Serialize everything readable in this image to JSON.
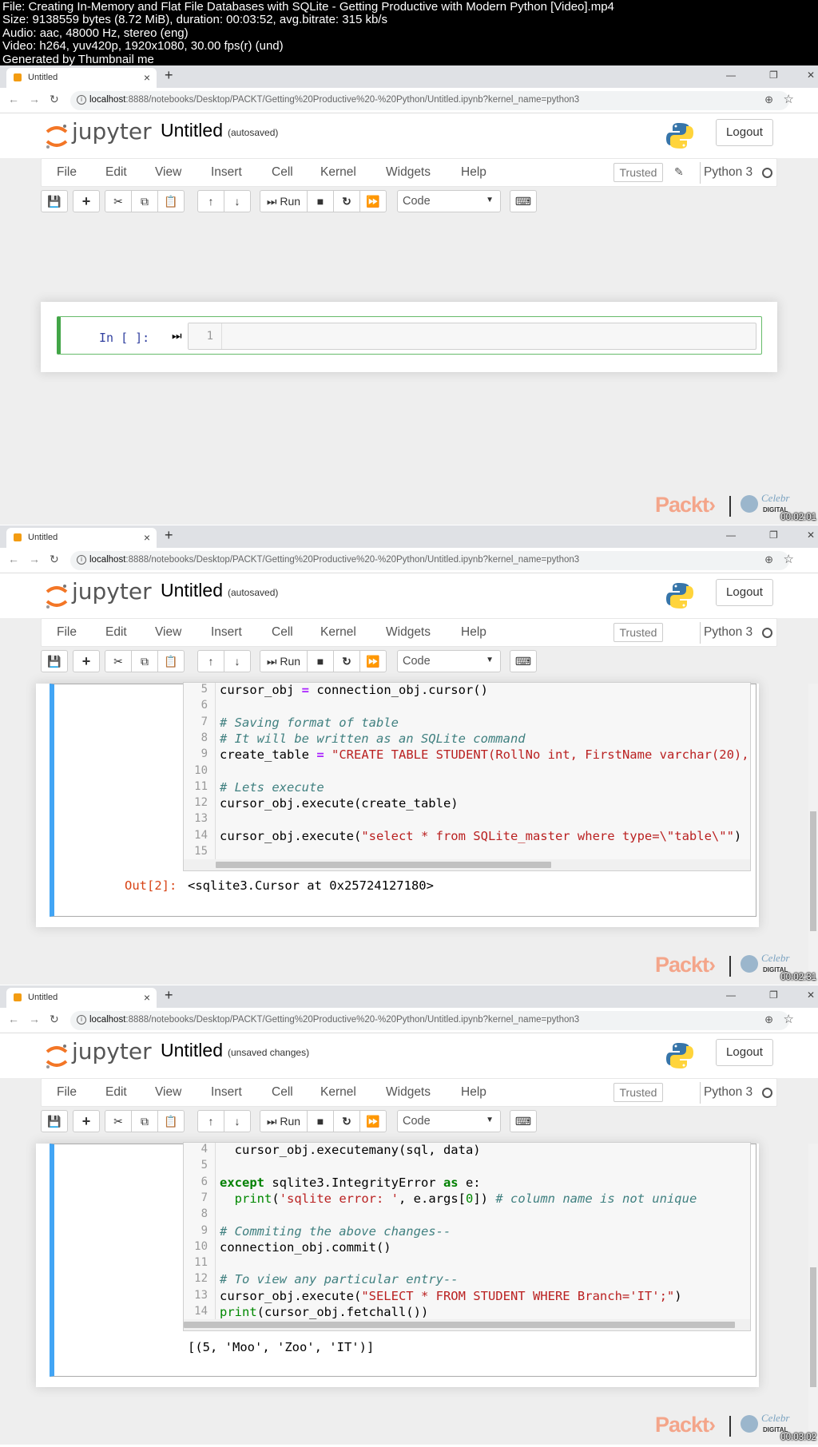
{
  "info": {
    "line1": "File: Creating In-Memory and Flat File Databases with SQLite - Getting Productive with Modern Python [Video].mp4",
    "line2": "Size: 9138559 bytes (8.72 MiB), duration: 00:03:52, avg.bitrate: 315 kb/s",
    "line3": "Audio: aac, 48000 Hz, stereo (eng)",
    "line4": "Video: h264, yuv420p, 1920x1080, 30.00 fps(r) (und)",
    "line5": "Generated by Thumbnail me"
  },
  "browser": {
    "tab_title": "Untitled",
    "tab_close": "×",
    "new_tab": "+",
    "url_host": "localhost",
    "url_path": ":8888/notebooks/Desktop/PACKT/Getting%20Productive%20-%20Python/Untitled.ipynb?kernel_name=python3",
    "win_min": "—",
    "win_max": "❐",
    "win_close": "✕"
  },
  "jupyter": {
    "logo_text": "jupyter",
    "notebook_name": "Untitled",
    "logout": "Logout",
    "trusted": "Trusted",
    "kernel": "Python 3",
    "menu": [
      "File",
      "Edit",
      "View",
      "Insert",
      "Cell",
      "Kernel",
      "Widgets",
      "Help"
    ],
    "run_label": "Run",
    "cell_type": "Code"
  },
  "frames": [
    {
      "autosave": "(autosaved)",
      "timestamp": "00:02:01",
      "prompt": "In [ ]:",
      "line_no": "1"
    },
    {
      "autosave": "(autosaved)",
      "timestamp": "00:02:31",
      "out_prompt": "Out[2]:",
      "output": "<sqlite3.Cursor at 0x25724127180>"
    },
    {
      "autosave": "(unsaved changes)",
      "timestamp": "00:03:02",
      "output": "[(5, 'Moo', 'Zoo', 'IT')]"
    }
  ],
  "brand": {
    "packt": "Packt›",
    "celebr": "Celebr",
    "digital": "DIGITAL"
  },
  "colors": {
    "edit_mode_border": "#42a547",
    "command_mode_border": "#42a5f5",
    "packt": "#f4a58a"
  }
}
